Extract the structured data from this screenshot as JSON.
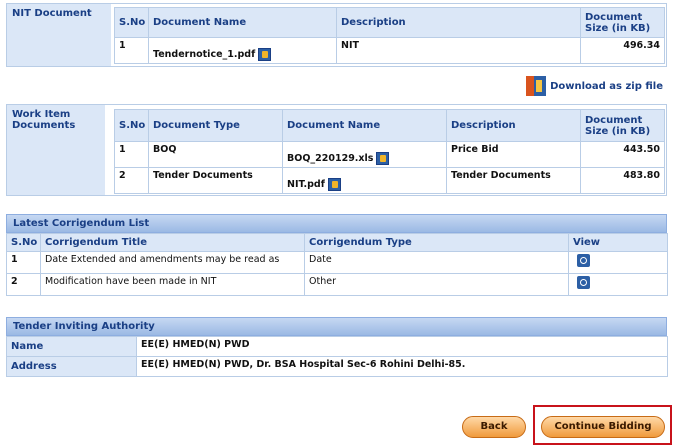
{
  "nit_section": {
    "label": "NIT Document",
    "headers": [
      "S.No",
      "Document Name",
      "Description",
      "Document Size (in KB)"
    ],
    "rows": [
      {
        "sno": "1",
        "name": "Tendernotice_1.pdf",
        "desc": "NIT",
        "size": "496.34"
      }
    ]
  },
  "download_zip": {
    "label": "Download as zip file"
  },
  "work_item_section": {
    "label": "Work Item Documents",
    "headers": [
      "S.No",
      "Document Type",
      "Document Name",
      "Description",
      "Document Size (in KB)"
    ],
    "rows": [
      {
        "sno": "1",
        "type": "BOQ",
        "name": "BOQ_220129.xls",
        "desc": "Price Bid",
        "size": "443.50"
      },
      {
        "sno": "2",
        "type": "Tender Documents",
        "name": "NIT.pdf",
        "desc": "Tender Documents",
        "size": "483.80"
      }
    ]
  },
  "corrigendum": {
    "title": "Latest Corrigendum List",
    "headers": [
      "S.No",
      "Corrigendum Title",
      "Corrigendum Type",
      "View"
    ],
    "rows": [
      {
        "sno": "1",
        "title": "Date Extended and amendments may be read as",
        "type": "Date"
      },
      {
        "sno": "2",
        "title": "Modification have been made in NIT",
        "type": "Other"
      }
    ]
  },
  "authority": {
    "title": "Tender Inviting Authority",
    "name_label": "Name",
    "name_value": "EE(E) HMED(N) PWD",
    "address_label": "Address",
    "address_value": "EE(E) HMED(N) PWD, Dr. BSA Hospital Sec-6 Rohini Delhi-85."
  },
  "buttons": {
    "back": "Back",
    "continue": "Continue Bidding"
  },
  "colors": {
    "accent": "#1a3f85",
    "highlight": "#c8131b",
    "button": "#f09a3c"
  }
}
